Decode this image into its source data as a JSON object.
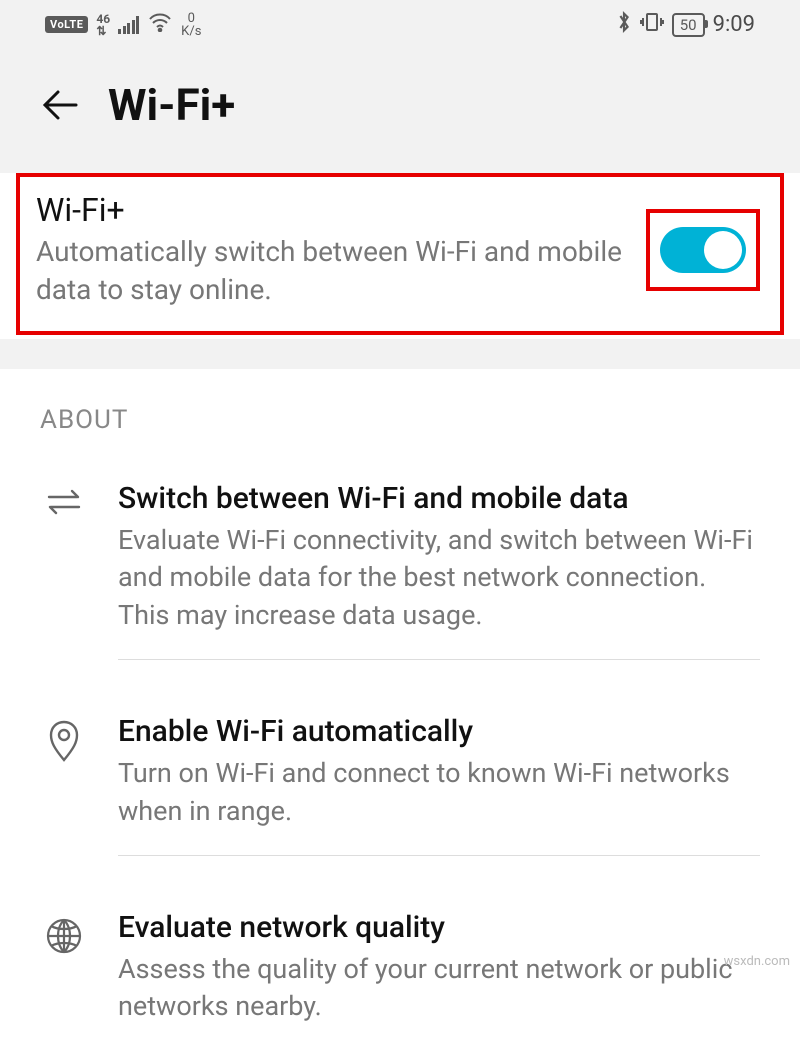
{
  "status": {
    "volte": "VoLTE",
    "net_label_top": "46",
    "net_label_bottom": "⇅",
    "speed_top": "0",
    "speed_bottom": "K/s",
    "bluetooth": "✱",
    "battery_level": "50",
    "time": "9:09"
  },
  "header": {
    "title": "Wi-Fi+"
  },
  "setting": {
    "title": "Wi-Fi+",
    "desc": "Automatically switch between Wi-Fi and mobile data to stay online.",
    "toggle_on": true
  },
  "section_label": "ABOUT",
  "about": [
    {
      "icon": "swap-icon",
      "title": "Switch between Wi-Fi and mobile data",
      "desc": "Evaluate Wi-Fi connectivity, and switch between Wi-Fi and mobile data for the best network connection. This may increase data usage."
    },
    {
      "icon": "location-icon",
      "title": "Enable Wi-Fi automatically",
      "desc": "Turn on Wi-Fi and connect to known Wi-Fi networks when in range."
    },
    {
      "icon": "globe-icon",
      "title": "Evaluate network quality",
      "desc": "Assess the quality of your current network or public networks nearby."
    }
  ],
  "watermark": "wsxdn.com"
}
